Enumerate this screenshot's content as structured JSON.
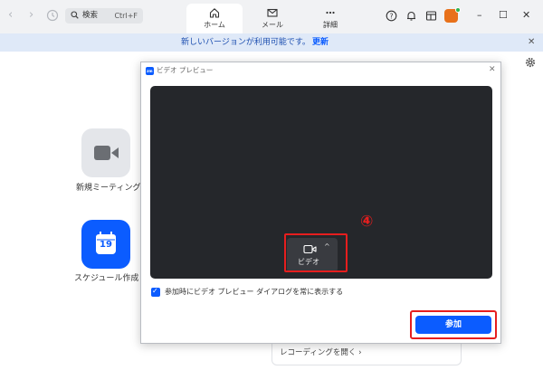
{
  "titlebar": {
    "nav_back": "‹",
    "nav_forward": "›",
    "search_label": "検索",
    "search_shortcut": "Ctrl+F",
    "tabs": [
      {
        "label": "ホーム",
        "icon": "home-icon",
        "active": true
      },
      {
        "label": "メール",
        "icon": "mail-icon",
        "active": false
      },
      {
        "label": "詳細",
        "icon": "more-icon",
        "active": false
      }
    ],
    "right_icons": [
      "help-icon",
      "bell-icon",
      "whiteboard-icon"
    ],
    "window_controls": {
      "minimize": "–",
      "maximize": "☐",
      "close": "✕"
    }
  },
  "banner": {
    "text": "新しいバージョンが利用可能です。",
    "link": "更新",
    "close": "✕"
  },
  "home": {
    "tiles": [
      {
        "label": "新規ミーティング",
        "icon": "video-camera-icon"
      },
      {
        "label": "スケジュール作成",
        "icon": "calendar-icon",
        "date": "19"
      }
    ],
    "recording_link": "レコーディングを開く ›"
  },
  "dialog": {
    "logo": "zm",
    "title": "ビデオ プレビュー",
    "close": "✕",
    "annotation": "④",
    "video_button": "ビデオ",
    "video_caret": "^",
    "checkbox_checked": true,
    "checkbox_label": "参加時にビデオ プレビュー ダイアログを常に表示する",
    "join_button": "参加"
  },
  "colors": {
    "accent": "#0b5cff",
    "highlight": "#e61e1e",
    "preview_bg": "#25272b",
    "banner_bg": "#dfe9f8"
  }
}
